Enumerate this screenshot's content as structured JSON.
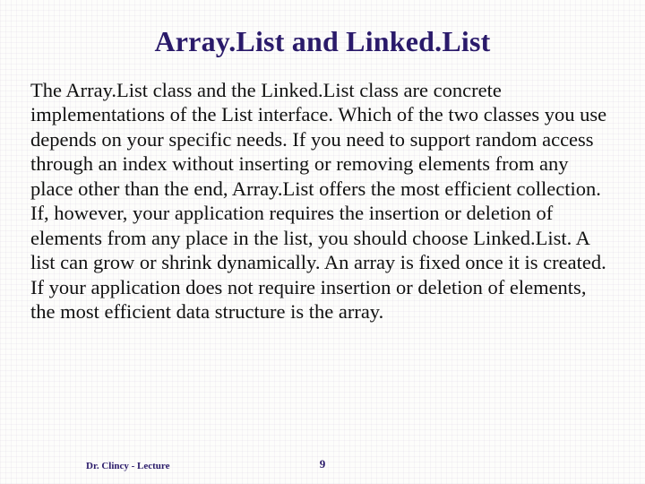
{
  "slide": {
    "title": "Array.List and Linked.List",
    "body": "The Array.List class and the Linked.List class are concrete implementations of the List interface. Which of the two classes you use depends on your specific needs. If you need to support random access through an index without inserting or removing elements from any place other than the end, Array.List offers the most efficient collection. If, however, your application requires the insertion or deletion of elements from any place in the list, you should choose Linked.List. A list can grow or shrink dynamically. An array is fixed once it is created. If your application does not require insertion or deletion of elements, the most efficient data structure is the array.",
    "footer_left": "Dr. Clincy - Lecture",
    "page_number": "9"
  }
}
